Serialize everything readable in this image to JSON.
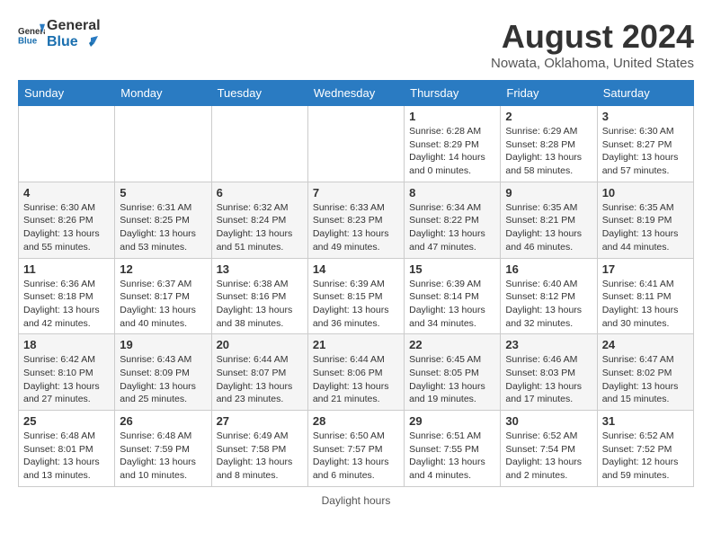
{
  "header": {
    "logo_line1": "General",
    "logo_line2": "Blue",
    "month_year": "August 2024",
    "location": "Nowata, Oklahoma, United States"
  },
  "weekdays": [
    "Sunday",
    "Monday",
    "Tuesday",
    "Wednesday",
    "Thursday",
    "Friday",
    "Saturday"
  ],
  "weeks": [
    [
      {
        "day": "",
        "info": ""
      },
      {
        "day": "",
        "info": ""
      },
      {
        "day": "",
        "info": ""
      },
      {
        "day": "",
        "info": ""
      },
      {
        "day": "1",
        "info": "Sunrise: 6:28 AM\nSunset: 8:29 PM\nDaylight: 14 hours\nand 0 minutes."
      },
      {
        "day": "2",
        "info": "Sunrise: 6:29 AM\nSunset: 8:28 PM\nDaylight: 13 hours\nand 58 minutes."
      },
      {
        "day": "3",
        "info": "Sunrise: 6:30 AM\nSunset: 8:27 PM\nDaylight: 13 hours\nand 57 minutes."
      }
    ],
    [
      {
        "day": "4",
        "info": "Sunrise: 6:30 AM\nSunset: 8:26 PM\nDaylight: 13 hours\nand 55 minutes."
      },
      {
        "day": "5",
        "info": "Sunrise: 6:31 AM\nSunset: 8:25 PM\nDaylight: 13 hours\nand 53 minutes."
      },
      {
        "day": "6",
        "info": "Sunrise: 6:32 AM\nSunset: 8:24 PM\nDaylight: 13 hours\nand 51 minutes."
      },
      {
        "day": "7",
        "info": "Sunrise: 6:33 AM\nSunset: 8:23 PM\nDaylight: 13 hours\nand 49 minutes."
      },
      {
        "day": "8",
        "info": "Sunrise: 6:34 AM\nSunset: 8:22 PM\nDaylight: 13 hours\nand 47 minutes."
      },
      {
        "day": "9",
        "info": "Sunrise: 6:35 AM\nSunset: 8:21 PM\nDaylight: 13 hours\nand 46 minutes."
      },
      {
        "day": "10",
        "info": "Sunrise: 6:35 AM\nSunset: 8:19 PM\nDaylight: 13 hours\nand 44 minutes."
      }
    ],
    [
      {
        "day": "11",
        "info": "Sunrise: 6:36 AM\nSunset: 8:18 PM\nDaylight: 13 hours\nand 42 minutes."
      },
      {
        "day": "12",
        "info": "Sunrise: 6:37 AM\nSunset: 8:17 PM\nDaylight: 13 hours\nand 40 minutes."
      },
      {
        "day": "13",
        "info": "Sunrise: 6:38 AM\nSunset: 8:16 PM\nDaylight: 13 hours\nand 38 minutes."
      },
      {
        "day": "14",
        "info": "Sunrise: 6:39 AM\nSunset: 8:15 PM\nDaylight: 13 hours\nand 36 minutes."
      },
      {
        "day": "15",
        "info": "Sunrise: 6:39 AM\nSunset: 8:14 PM\nDaylight: 13 hours\nand 34 minutes."
      },
      {
        "day": "16",
        "info": "Sunrise: 6:40 AM\nSunset: 8:12 PM\nDaylight: 13 hours\nand 32 minutes."
      },
      {
        "day": "17",
        "info": "Sunrise: 6:41 AM\nSunset: 8:11 PM\nDaylight: 13 hours\nand 30 minutes."
      }
    ],
    [
      {
        "day": "18",
        "info": "Sunrise: 6:42 AM\nSunset: 8:10 PM\nDaylight: 13 hours\nand 27 minutes."
      },
      {
        "day": "19",
        "info": "Sunrise: 6:43 AM\nSunset: 8:09 PM\nDaylight: 13 hours\nand 25 minutes."
      },
      {
        "day": "20",
        "info": "Sunrise: 6:44 AM\nSunset: 8:07 PM\nDaylight: 13 hours\nand 23 minutes."
      },
      {
        "day": "21",
        "info": "Sunrise: 6:44 AM\nSunset: 8:06 PM\nDaylight: 13 hours\nand 21 minutes."
      },
      {
        "day": "22",
        "info": "Sunrise: 6:45 AM\nSunset: 8:05 PM\nDaylight: 13 hours\nand 19 minutes."
      },
      {
        "day": "23",
        "info": "Sunrise: 6:46 AM\nSunset: 8:03 PM\nDaylight: 13 hours\nand 17 minutes."
      },
      {
        "day": "24",
        "info": "Sunrise: 6:47 AM\nSunset: 8:02 PM\nDaylight: 13 hours\nand 15 minutes."
      }
    ],
    [
      {
        "day": "25",
        "info": "Sunrise: 6:48 AM\nSunset: 8:01 PM\nDaylight: 13 hours\nand 13 minutes."
      },
      {
        "day": "26",
        "info": "Sunrise: 6:48 AM\nSunset: 7:59 PM\nDaylight: 13 hours\nand 10 minutes."
      },
      {
        "day": "27",
        "info": "Sunrise: 6:49 AM\nSunset: 7:58 PM\nDaylight: 13 hours\nand 8 minutes."
      },
      {
        "day": "28",
        "info": "Sunrise: 6:50 AM\nSunset: 7:57 PM\nDaylight: 13 hours\nand 6 minutes."
      },
      {
        "day": "29",
        "info": "Sunrise: 6:51 AM\nSunset: 7:55 PM\nDaylight: 13 hours\nand 4 minutes."
      },
      {
        "day": "30",
        "info": "Sunrise: 6:52 AM\nSunset: 7:54 PM\nDaylight: 13 hours\nand 2 minutes."
      },
      {
        "day": "31",
        "info": "Sunrise: 6:52 AM\nSunset: 7:52 PM\nDaylight: 12 hours\nand 59 minutes."
      }
    ]
  ],
  "footer": "Daylight hours"
}
